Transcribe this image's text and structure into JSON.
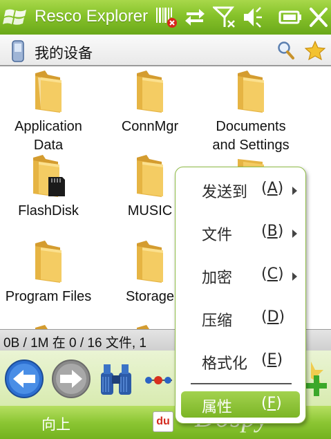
{
  "titlebar": {
    "app_title": "Resco Explorer"
  },
  "location": {
    "title": "我的设备"
  },
  "files": [
    {
      "name_line1": "Application",
      "name_line2": "Data",
      "icon": "folder-icon"
    },
    {
      "name_line1": "ConnMgr",
      "name_line2": "",
      "icon": "folder-icon"
    },
    {
      "name_line1": "Documents",
      "name_line2": "and Settings",
      "icon": "folder-icon"
    },
    {
      "name_line1": "FlashDisk",
      "name_line2": "",
      "icon": "folder-sdcard-icon"
    },
    {
      "name_line1": "MUSIC",
      "name_line2": "",
      "icon": "folder-icon"
    },
    {
      "name_line1": "Program Files",
      "name_line2": "",
      "icon": "folder-icon"
    },
    {
      "name_line1": "Storage",
      "name_line2": "",
      "icon": "folder-icon"
    }
  ],
  "status": {
    "text": "0B / 1M 在 0 / 16 文件, 1"
  },
  "softkeys": {
    "left": "向上"
  },
  "du_badge": "du",
  "watermark": "Dospy",
  "context_menu": {
    "items": [
      {
        "label": "发送到",
        "key_open": "(",
        "key": "A",
        "key_close": ")",
        "submenu": true
      },
      {
        "label": "文件",
        "key_open": "(",
        "key": "B",
        "key_close": ")",
        "submenu": true
      },
      {
        "label": "加密",
        "key_open": "(",
        "key": "C",
        "key_close": ")",
        "submenu": true
      },
      {
        "label": "压缩",
        "key_open": "(",
        "key": "D",
        "key_close": ")",
        "submenu": false
      },
      {
        "label": "格式化",
        "key_open": "(",
        "key": "E",
        "key_close": ")",
        "submenu": false
      }
    ],
    "selected": {
      "label": "属性",
      "key_open": "(",
      "key": "F",
      "key_close": ")"
    }
  },
  "colors": {
    "accent_green": "#86c22a",
    "menu_border": "#8fbc45",
    "folder": "#f2c95d"
  }
}
